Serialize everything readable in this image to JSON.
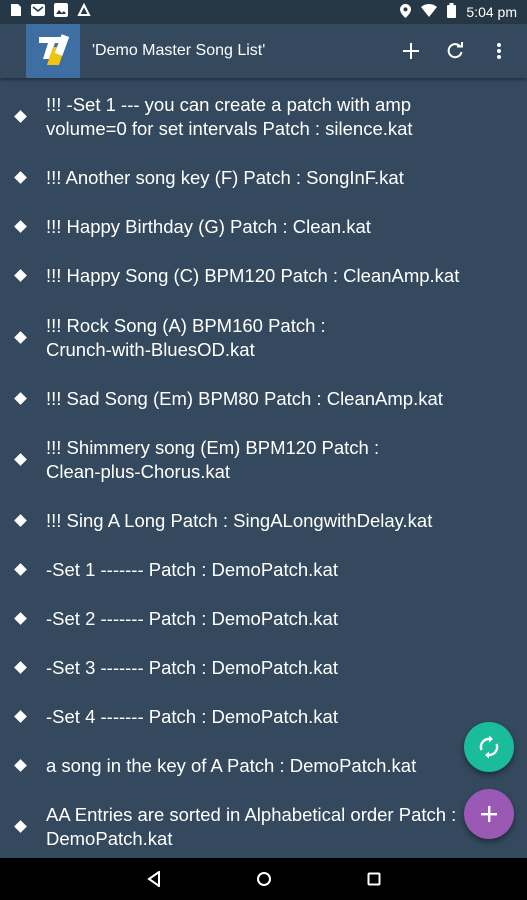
{
  "status_bar": {
    "time": "5:04",
    "time_suffix": "pm",
    "left_icons": [
      "sim-icon",
      "mail-icon",
      "gallery-icon",
      "app-notification-icon"
    ],
    "right_icons": [
      "location-icon",
      "wifi-icon",
      "battery-icon"
    ]
  },
  "app_bar": {
    "title": "'Demo Master Song List'",
    "actions": [
      "add-icon",
      "refresh-icon",
      "overflow-menu-icon"
    ]
  },
  "songs": [
    {
      "lines": [
        "!!! -Set 1 --- you can create a patch with amp",
        "volume=0 for set intervals Patch : silence.kat"
      ]
    },
    {
      "lines": [
        "!!! Another song key (F) Patch : SongInF.kat"
      ]
    },
    {
      "lines": [
        "!!! Happy Birthday (G) Patch : Clean.kat"
      ]
    },
    {
      "lines": [
        "!!! Happy Song (C) BPM120 Patch : CleanAmp.kat"
      ]
    },
    {
      "lines": [
        "!!! Rock Song (A) BPM160 Patch :",
        "Crunch-with-BluesOD.kat"
      ]
    },
    {
      "lines": [
        "!!! Sad Song (Em) BPM80 Patch : CleanAmp.kat"
      ]
    },
    {
      "lines": [
        "!!! Shimmery song (Em) BPM120 Patch :",
        "Clean-plus-Chorus.kat"
      ]
    },
    {
      "lines": [
        "!!! Sing A Long Patch : SingALongwithDelay.kat"
      ]
    },
    {
      "lines": [
        "-Set 1 ------- Patch : DemoPatch.kat"
      ]
    },
    {
      "lines": [
        "-Set 2 ------- Patch : DemoPatch.kat"
      ]
    },
    {
      "lines": [
        "-Set 3 ------- Patch : DemoPatch.kat"
      ]
    },
    {
      "lines": [
        "-Set 4 ------- Patch : DemoPatch.kat"
      ]
    },
    {
      "lines": [
        "a song in the key of A Patch : DemoPatch.kat"
      ]
    },
    {
      "lines": [
        "AA Entries are sorted in Alphabetical order Patch :",
        "DemoPatch.kat"
      ]
    }
  ],
  "fabs": {
    "sync": {
      "icon": "sync-icon",
      "color": "#1abc9c"
    },
    "add": {
      "icon": "add-icon",
      "color": "#9b59b6"
    }
  },
  "nav_bar": {
    "buttons": [
      "back-icon",
      "home-icon",
      "recents-icon"
    ]
  },
  "colors": {
    "background": "#34495e",
    "status_bar": "#263746",
    "logo": "#3f6ea3"
  }
}
